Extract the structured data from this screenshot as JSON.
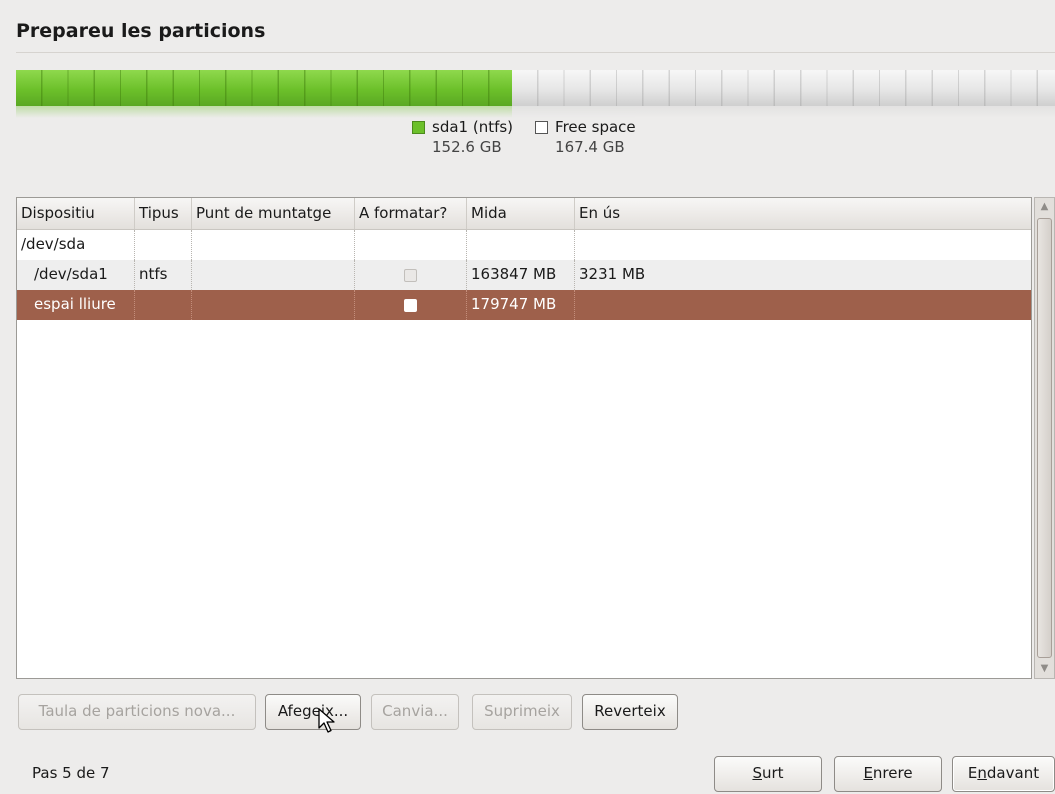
{
  "page": {
    "title": "Prepareu les particions"
  },
  "partition_bar": {
    "segments": [
      {
        "name": "sda1 (ntfs)",
        "size": "152.6 GB",
        "fraction": 0.477,
        "color": "#6cc02a"
      },
      {
        "name": "Free space",
        "size": "167.4 GB",
        "fraction": 0.523,
        "color": "#ffffff"
      }
    ]
  },
  "table": {
    "headers": [
      "Dispositiu",
      "Tipus",
      "Punt de muntatge",
      "A formatar?",
      "Mida",
      "En ús"
    ],
    "rows": [
      {
        "device": "/dev/sda",
        "type": "",
        "mount": "",
        "format": null,
        "size": "",
        "used": ""
      },
      {
        "device": "/dev/sda1",
        "type": "ntfs",
        "mount": "",
        "format": "disabled",
        "size": "163847 MB",
        "used": "3231 MB"
      },
      {
        "device": "espai lliure",
        "type": "",
        "mount": "",
        "format": "unchecked",
        "size": "179747 MB",
        "used": "",
        "selected": true
      }
    ]
  },
  "actions": {
    "new_table": "Taula de particions nova...",
    "add": "Afegeix...",
    "change": "Canvia...",
    "delete": "Suprimeix",
    "revert": "Reverteix"
  },
  "footer": {
    "step": "Pas 5 de 7",
    "quit": "Surt",
    "back": "Enrere",
    "forward": "Endavant"
  },
  "colors": {
    "selection": "#9e604b",
    "used_partition": "#6cc02a"
  }
}
